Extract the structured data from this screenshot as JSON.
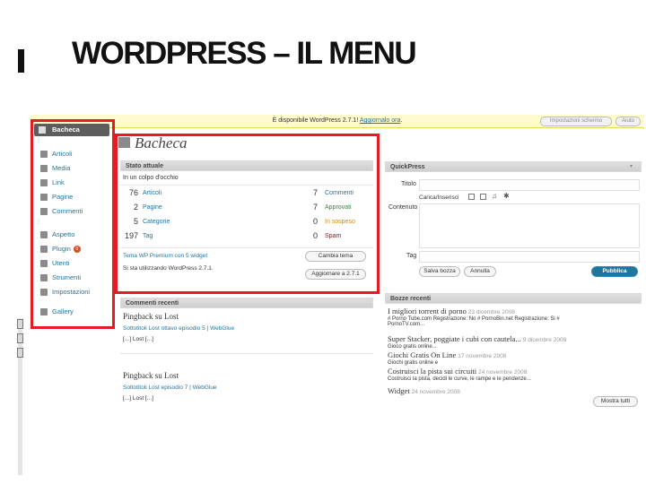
{
  "slide": {
    "title": "WORDPRESS – IL MENU"
  },
  "notice": {
    "text": "È disponibile WordPress 2.7.1!",
    "link": "Aggiornalo ora",
    "suffix": ".",
    "screen_options": "Impostazioni schermo",
    "help": "Aiuto"
  },
  "sidebar": {
    "dashboard": "Bacheca",
    "items": [
      {
        "label": "Articoli",
        "icon": "pin-icon"
      },
      {
        "label": "Media",
        "icon": "media-icon"
      },
      {
        "label": "Link",
        "icon": "link-icon"
      },
      {
        "label": "Pagine",
        "icon": "page-icon"
      },
      {
        "label": "Commenti",
        "icon": "comment-icon"
      },
      {
        "label": "Aspetto",
        "icon": "appearance-icon"
      },
      {
        "label": "Plugin",
        "icon": "plugin-icon",
        "badge": "0"
      },
      {
        "label": "Utenti",
        "icon": "users-icon"
      },
      {
        "label": "Strumenti",
        "icon": "tools-icon"
      },
      {
        "label": "Impostazioni",
        "icon": "settings-icon"
      },
      {
        "label": "Gallery",
        "icon": "gallery-icon"
      }
    ]
  },
  "main": {
    "heading": "Bacheca"
  },
  "right_now": {
    "title": "Stato attuale",
    "subtitle": "In un colpo d'occhio",
    "content_rows": [
      {
        "count": "76",
        "label": "Articoli"
      },
      {
        "count": "2",
        "label": "Pagine"
      },
      {
        "count": "5",
        "label": "Categorie"
      },
      {
        "count": "197",
        "label": "Tag"
      }
    ],
    "discussion_rows": [
      {
        "count": "7",
        "label": "Commenti"
      },
      {
        "count": "7",
        "label": "Approvati"
      },
      {
        "count": "0",
        "label": "In sospeso"
      },
      {
        "count": "0",
        "label": "Spam"
      }
    ],
    "theme_line": "Tema WP Premium con 5 widget",
    "change_theme": "Cambia tema",
    "version_line": "Si sta utilizzando WordPress 2.7.1.",
    "update_button": "Aggiornare a 2.7.1"
  },
  "recent_comments": {
    "title": "Commenti recenti",
    "entries": [
      {
        "title": "Pingback su Lost",
        "link": "Sottotitoli Lost ottavo episodio 5 | WebGlue",
        "text": "[...] Lost [...]"
      },
      {
        "title": "Pingback su Lost",
        "link": "Sottotitoli Lost episodio 7 | WebGlue",
        "text": "[...] Lost [...]"
      }
    ]
  },
  "quickpress": {
    "title": "QuickPress",
    "title_label": "Titolo",
    "upload_label": "Carica/Inserisci",
    "content_label": "Contenuto",
    "tags_label": "Tag",
    "save_draft": "Salva bozza",
    "cancel": "Annulla",
    "publish": "Pubblica"
  },
  "recent_drafts": {
    "title": "Bozze recenti",
    "items": [
      {
        "title": "I migliori torrent di porno",
        "date": "23 dicembre 2008",
        "excerpt": "# Porno Tube.com Registrazione: No # PornoBin.net Registrazione: Si #",
        "excerpt2": "PornoTV.com..."
      },
      {
        "title": "Super Stacker, poggiate i cubi con cautela...",
        "date": "9 dicembre 2008",
        "excerpt": "Gioco gratis online..."
      },
      {
        "title": "Giochi Gratis On Line",
        "date": "17 novembre 2008",
        "excerpt": "Giochi gratis online e"
      },
      {
        "title": "Costruisci la pista sui circuiti",
        "date": "24 novembre 2008",
        "excerpt": "Costruisci la pista, decidi le curve, le rampe e le pendenze..."
      },
      {
        "title": "Widget",
        "date": "24 novembre 2008"
      }
    ],
    "view_all": "Mostra tutti"
  }
}
